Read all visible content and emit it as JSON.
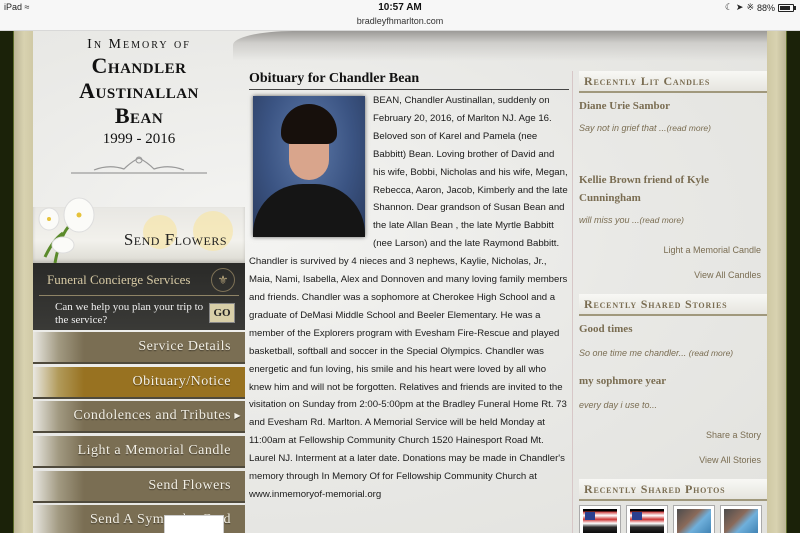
{
  "status_bar": {
    "device": "iPad",
    "time": "10:57 AM",
    "url": "bradleyfhmarlton.com",
    "battery": "88%"
  },
  "memorial": {
    "in_memory_of": "In Memory of",
    "name_lines": [
      "Chandler",
      "Austinallan",
      "Bean"
    ],
    "dates": "1999 - 2016"
  },
  "send_flowers_banner": {
    "label": "Send Flowers"
  },
  "concierge": {
    "title": "Funeral Concierge Services",
    "prompt": "Can we help you plan your trip to the service?",
    "go_label": "GO"
  },
  "nav": {
    "items": [
      {
        "label": "Service Details",
        "active": false
      },
      {
        "label": "Obituary/Notice",
        "active": true
      },
      {
        "label": "Condolences and Tributes",
        "active": false,
        "has_submenu": true
      },
      {
        "label": "Light a Memorial Candle",
        "active": false
      },
      {
        "label": "Send Flowers",
        "active": false
      },
      {
        "label": "Send A Sympathy Card",
        "active": false
      }
    ]
  },
  "obituary": {
    "title": "Obituary for Chandler Bean",
    "body": "BEAN, Chandler Austinallan, suddenly on February 20, 2016, of Marlton NJ. Age 16. Beloved son of Karel and Pamela (nee Babbitt) Bean. Loving brother of David and his wife, Bobbi, Nicholas and his wife, Megan, Rebecca, Aaron, Jacob, Kimberly and the late Shannon. Dear grandson of Susan Bean and the late Allan Bean , the late Myrtle Babbitt (nee Larson) and the late Raymond Babbitt. Chandler is survived by 4 nieces and 3 nephews, Kaylie, Nicholas, Jr., Maia, Nami, Isabella, Alex and Donnoven and many loving family members and friends. Chandler was a sophomore at Cherokee High School and a graduate of DeMasi Middle School and Beeler Elementary. He was a member of the Explorers program with Evesham Fire-Rescue and played basketball, softball and soccer in the Special Olympics. Chandler was energetic and fun loving, his smile and his heart were loved by all who knew him and will not be forgotten. Relatives and friends are invited to the visitation on Sunday from 2:00-5:00pm at the Bradley Funeral Home Rt. 73 and Evesham Rd. Marlton. A Memorial Service will be held Monday at 11:00am at Fellowship Community Church 1520 Hainesport Road Mt. Laurel NJ. Interment at a later date. Donations may be made in Chandler's memory through In Memory Of for Fellowship Community Church at www.inmemoryof-memorial.org"
  },
  "candles": {
    "header": "Recently Lit Candles",
    "entries": [
      {
        "name": "Diane Urie Sambor",
        "excerpt": "Say not in grief that ...",
        "read_more": "(read more)"
      },
      {
        "name": "Kellie Brown friend of Kyle Cunningham",
        "excerpt": "will miss you ...",
        "read_more": "(read more)"
      }
    ],
    "links": [
      "Light a Memorial Candle",
      "View All Candles"
    ]
  },
  "stories": {
    "header": "Recently Shared Stories",
    "entries": [
      {
        "name": "Good times",
        "excerpt": "So one time me chandler... ",
        "read_more": "(read more)"
      },
      {
        "name": "my sophmore year",
        "excerpt": "every day i use to...",
        "read_more": ""
      }
    ],
    "links": [
      "Share a Story",
      "View All Stories"
    ]
  },
  "photos": {
    "header": "Recently Shared Photos",
    "thumbnails": [
      "flag-photo",
      "flag-photo",
      "child-photo",
      "child-photo"
    ]
  }
}
